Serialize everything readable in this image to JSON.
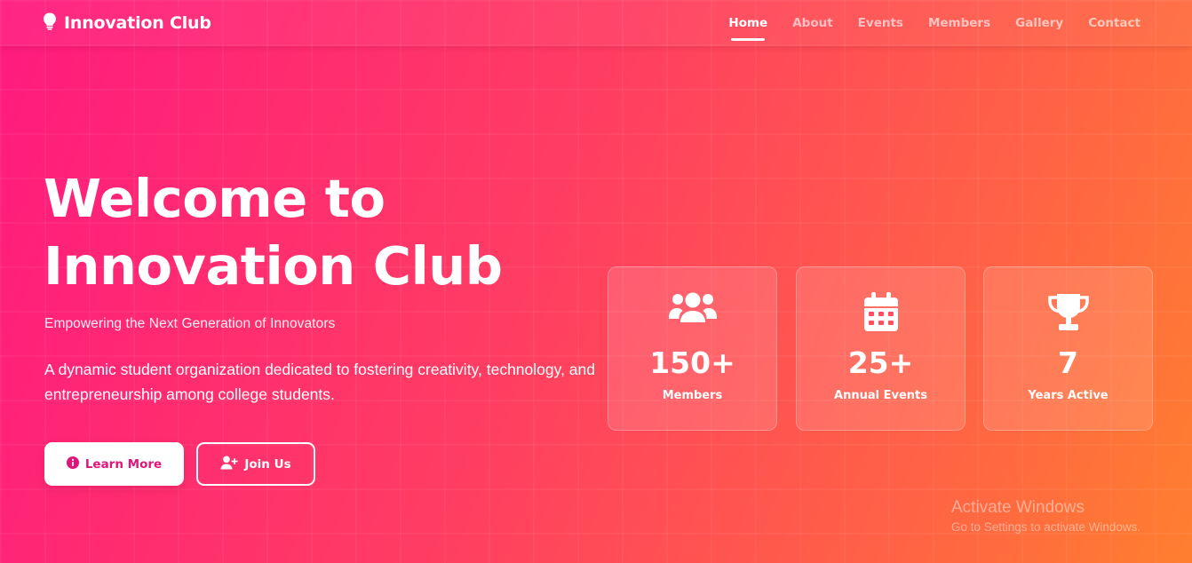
{
  "navbar": {
    "brand_name": "Innovation Club",
    "brand_icon": "lightbulb-icon",
    "links": [
      {
        "label": "Home",
        "active": true
      },
      {
        "label": "About",
        "active": false
      },
      {
        "label": "Events",
        "active": false
      },
      {
        "label": "Members",
        "active": false
      },
      {
        "label": "Gallery",
        "active": false
      },
      {
        "label": "Contact",
        "active": false
      }
    ]
  },
  "hero": {
    "title_line1": "Welcome to",
    "title_line2": "Innovation Club",
    "subtitle": "Empowering the Next Generation of Innovators",
    "description": "A dynamic student organization dedicated to fostering creativity, technology, and entrepreneurship among college students.",
    "buttons": {
      "learn_more": {
        "label": "Learn More",
        "icon": "info-circle-icon"
      },
      "join_us": {
        "label": "Join Us",
        "icon": "user-plus-icon"
      }
    }
  },
  "stats": [
    {
      "value": "150+",
      "label": "Members",
      "icon": "users-icon"
    },
    {
      "value": "25+",
      "label": "Annual Events",
      "icon": "calendar-icon"
    },
    {
      "value": "7",
      "label": "Years Active",
      "icon": "trophy-icon"
    }
  ],
  "watermark": {
    "title": "Activate Windows",
    "subtitle": "Go to Settings to activate Windows."
  },
  "colors": {
    "gradient_start": "#ff1a7f",
    "gradient_end": "#ff7f2f",
    "primary_button_text": "#e0157a"
  }
}
